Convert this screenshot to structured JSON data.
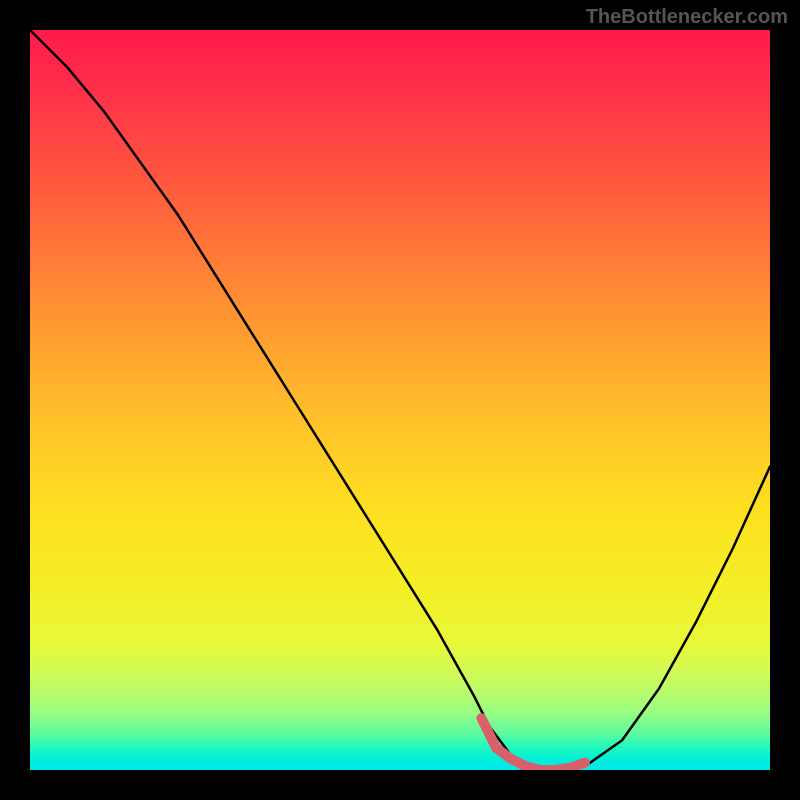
{
  "attribution": "TheBottlenecker.com",
  "chart_data": {
    "type": "line",
    "title": "",
    "xlabel": "",
    "ylabel": "",
    "xlim": [
      0,
      100
    ],
    "ylim": [
      0,
      100
    ],
    "series": [
      {
        "name": "bottleneck-curve",
        "x": [
          0,
          5,
          10,
          15,
          20,
          25,
          30,
          35,
          40,
          45,
          50,
          55,
          60,
          62,
          65,
          68,
          70,
          72,
          75,
          80,
          85,
          90,
          95,
          100
        ],
        "y": [
          100,
          95,
          89,
          82,
          75,
          67,
          59,
          51,
          43,
          35,
          27,
          19,
          10,
          6,
          2,
          0.5,
          0,
          0,
          0.5,
          4,
          11,
          20,
          30,
          41
        ]
      },
      {
        "name": "highlight-segment",
        "x": [
          61,
          63,
          65,
          67,
          69,
          71,
          73,
          75
        ],
        "y": [
          7,
          3,
          1.5,
          0.5,
          0,
          0,
          0.3,
          1
        ]
      }
    ],
    "gradient_stops": [
      {
        "pos": 0,
        "color": "#ff1a4a"
      },
      {
        "pos": 50,
        "color": "#ffc020"
      },
      {
        "pos": 100,
        "color": "#00e8f0"
      }
    ]
  }
}
